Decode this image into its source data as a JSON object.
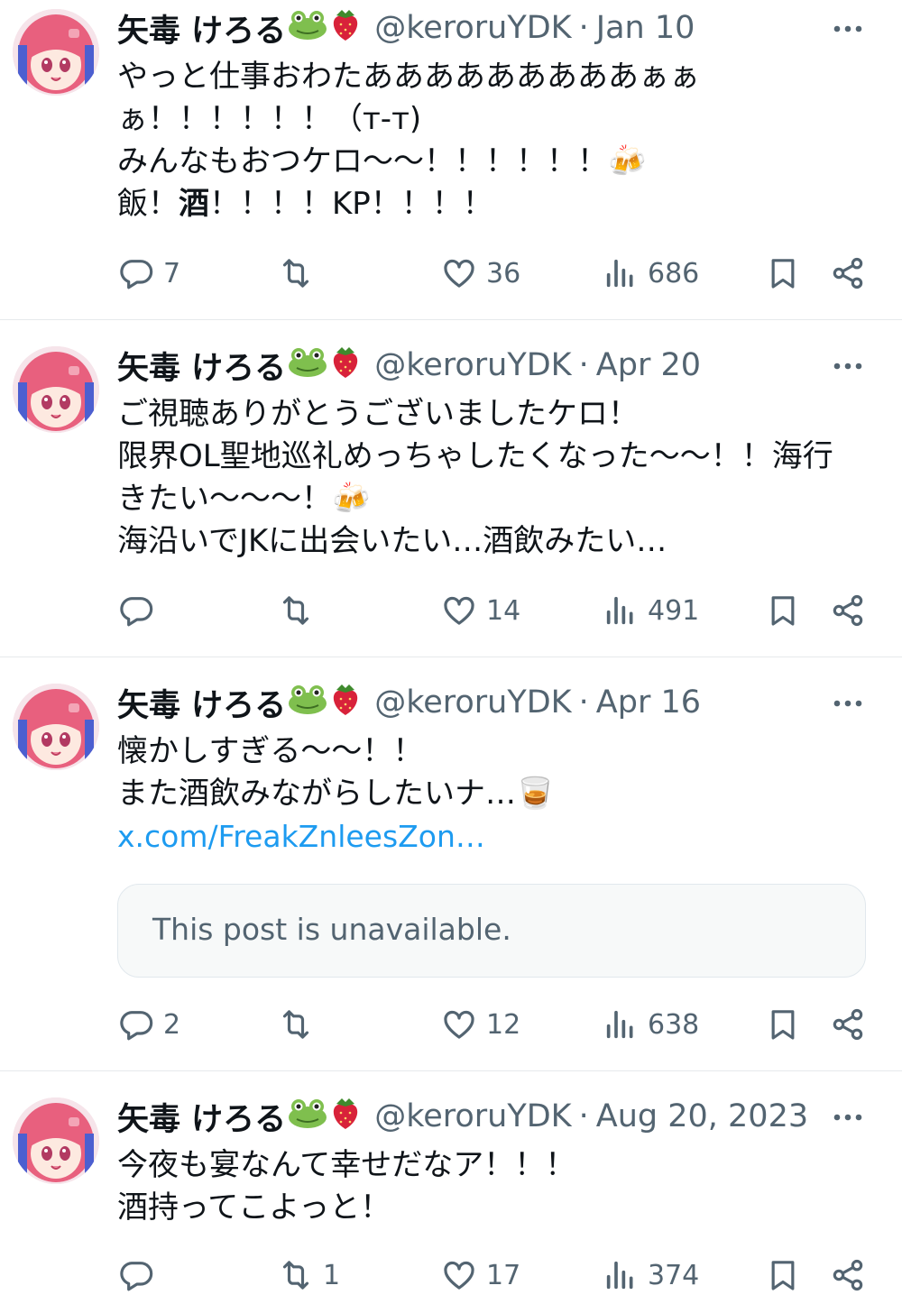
{
  "user": {
    "name": "矢毒 けろる",
    "handle": "@keroruYDK",
    "name_emojis": [
      "frog-face",
      "strawberry"
    ]
  },
  "tweets": [
    {
      "date": "Jan 10",
      "lines": [
        "やっと仕事おわたあああああああああぁぁ",
        "ぁ！！！！！！（т-т)",
        "みんなもおつケロ〜〜！！！！！！🍻"
      ],
      "line4_pre": "飯！",
      "line4_bold": "酒",
      "line4_post": "！！！！KP！！！！",
      "stats": {
        "replies": "7",
        "retweets": "",
        "likes": "36",
        "views": "686"
      }
    },
    {
      "date": "Apr 20",
      "lines": [
        "ご視聴ありがとうございましたケロ！",
        "限界OL聖地巡礼めっちゃしたくなった〜〜！！海行",
        "きたい〜〜〜！🍻",
        "海沿いでJKに出会いたい…酒飲みたい…"
      ],
      "stats": {
        "replies": "",
        "retweets": "",
        "likes": "14",
        "views": "491"
      }
    },
    {
      "date": "Apr 16",
      "lines": [
        "懐かしすぎる〜〜！！",
        "また酒飲みながらしたいナ…🥃"
      ],
      "link": "x.com/FreakZnleesZon…",
      "card_text": "This post is unavailable.",
      "stats": {
        "replies": "2",
        "retweets": "",
        "likes": "12",
        "views": "638"
      }
    },
    {
      "date": "Aug 20, 2023",
      "lines": [
        "今夜も宴なんて幸せだなア！！！",
        "酒持ってこよっと！"
      ],
      "stats": {
        "replies": "",
        "retweets": "1",
        "likes": "17",
        "views": "374"
      }
    }
  ],
  "separator": "·",
  "colors": {
    "text": "#0f1419",
    "secondary": "#536471",
    "link": "#1d9bf0",
    "divider": "#e6e9ec",
    "card_bg": "#f7f9f9"
  },
  "icons": [
    "reply-icon",
    "retweet-icon",
    "like-icon",
    "views-icon",
    "bookmark-icon",
    "share-icon",
    "more-icon"
  ]
}
